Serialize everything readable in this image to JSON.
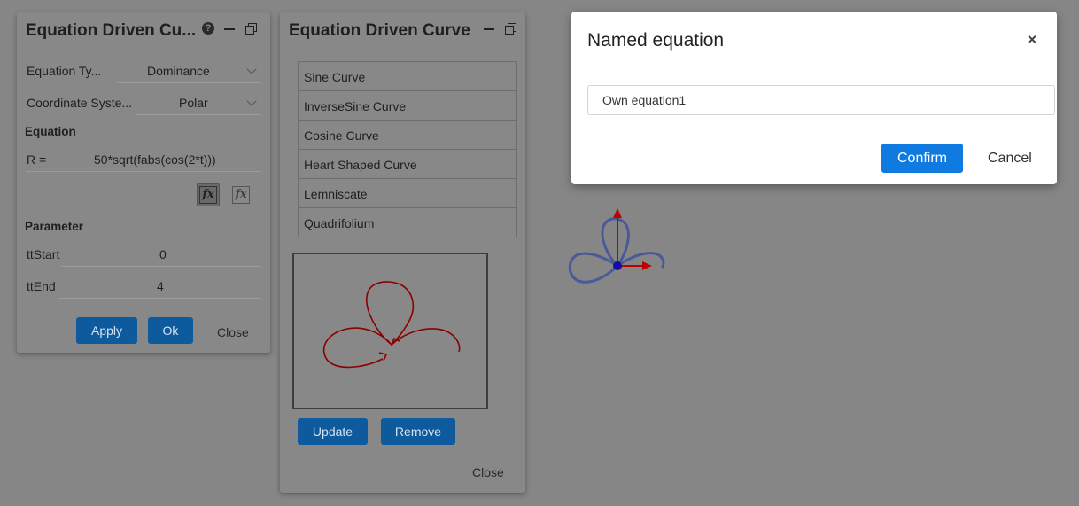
{
  "left_panel": {
    "title": "Equation Driven Cu...",
    "equation_type": {
      "label": "Equation Ty...",
      "value": "Dominance"
    },
    "coordinate_system": {
      "label": "Coordinate Syste...",
      "value": "Polar"
    },
    "equation_section": "Equation",
    "equation": {
      "label": "R =",
      "value": "50*sqrt(fabs(cos(2*t)))"
    },
    "fx_insert_icon": "fx",
    "fx_icon": "fx",
    "parameter_section": "Parameter",
    "t_start": {
      "label": "ttStart",
      "value": "0"
    },
    "t_end": {
      "label": "ttEnd",
      "value": "4"
    },
    "apply_label": "Apply",
    "ok_label": "Ok",
    "close_label": "Close"
  },
  "mid_panel": {
    "title": "Equation Driven Curve",
    "curves": [
      "Sine Curve",
      "InverseSine Curve",
      "Cosine Curve",
      "Heart Shaped Curve",
      "Lemniscate",
      "Quadrifolium"
    ],
    "update_label": "Update",
    "remove_label": "Remove",
    "close_label": "Close"
  },
  "dialog": {
    "title": "Named equation",
    "input_value": "Own equation1",
    "confirm_label": "Confirm",
    "cancel_label": "Cancel"
  },
  "colors": {
    "overlay": "#868686",
    "primary_button": "#0f7ae0",
    "preview_curve": "#8b0000",
    "viewport_curve": "#4a5a99",
    "axis_red": "#c00000"
  }
}
